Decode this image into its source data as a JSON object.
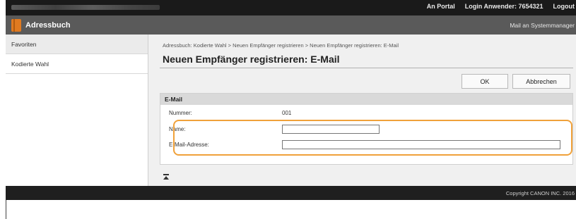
{
  "topbar": {
    "links": [
      "An Portal",
      "Login Anwender:  7654321",
      "Logout"
    ]
  },
  "titlebar": {
    "title": "Adressbuch",
    "mail_admin": "Mail an Systemmanager"
  },
  "sidebar": {
    "items": [
      {
        "label": "Favoriten"
      },
      {
        "label": "Kodierte Wahl"
      }
    ]
  },
  "main": {
    "breadcrumb": "Adressbuch: Kodierte Wahl > Neuen Empfänger registrieren > Neuen Empfänger registrieren: E-Mail",
    "page_title": "Neuen Empfänger registrieren: E-Mail",
    "buttons": {
      "ok_label": "OK",
      "cancel_label": "Abbrechen"
    },
    "panel": {
      "header": "E-Mail",
      "number_label": "Nummer:",
      "number_value": "001",
      "name_label": "Name:",
      "name_value": "",
      "email_label": "E-Mail-Adresse:",
      "email_value": ""
    }
  },
  "footer": {
    "copyright": "Copyright CANON INC. 2016"
  },
  "colors": {
    "highlight": "#f0a13a",
    "brand_icon": "#e07a20",
    "topbar": "#1a1a1a",
    "titlebar": "#5a5a5a"
  }
}
